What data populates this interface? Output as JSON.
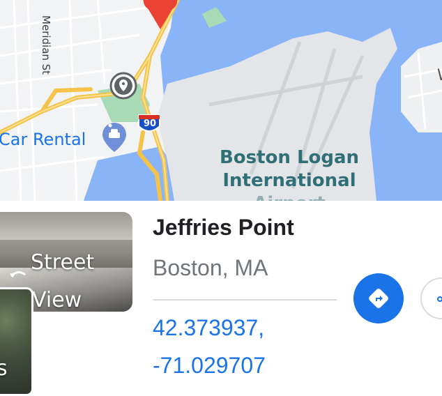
{
  "map": {
    "street_label": "Meridian St",
    "business_label": "Car Rental",
    "poi_label_lines": [
      "Boston Logan",
      "International",
      "Airport"
    ],
    "highway_shield": "90",
    "edge_letter": "W",
    "icons": {
      "pin": "red-location-pin-icon",
      "place_marker": "gray-place-marker-icon",
      "car_rental": "car-rental-icon",
      "shield": "interstate-shield-icon"
    },
    "colors": {
      "water": "#8ab4f8",
      "land": "#f1f3f4",
      "airport": "#e0e2e4",
      "park": "#a8dab5",
      "highway": "#fbc02d",
      "pin": "#ea4335"
    }
  },
  "panel": {
    "thumbnails": {
      "street_view_line1": "Street",
      "street_view_line2": "View",
      "satellite_letter": "s"
    },
    "title": "Jeffries Point",
    "subtitle": "Boston, MA",
    "coords_line1": "42.373937,",
    "coords_line2": "-71.029707",
    "buttons": {
      "directions_icon": "directions-icon",
      "share_icon": "share-icon"
    },
    "colors": {
      "accent": "#1a73e8",
      "title": "#202124",
      "muted": "#70757a"
    }
  }
}
